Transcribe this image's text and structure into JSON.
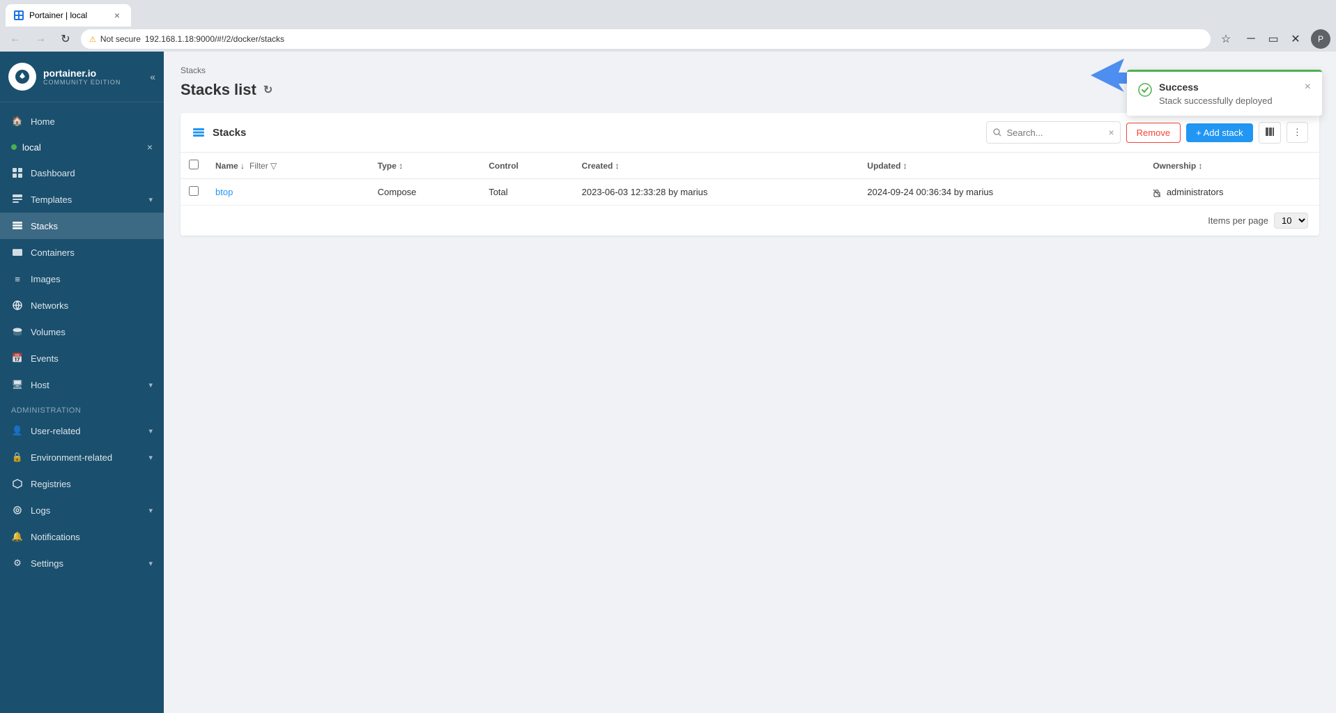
{
  "browser": {
    "tab_title": "Portainer | local",
    "address": "192.168.1.18:9000/#!/2/docker/stacks",
    "not_secure_label": "Not secure"
  },
  "sidebar": {
    "logo_name": "portainer.io",
    "logo_edition": "COMMUNITY EDITION",
    "collapse_btn": "«",
    "env_name": "local",
    "env_close": "×",
    "nav_items": [
      {
        "id": "home",
        "label": "Home",
        "icon": "🏠"
      },
      {
        "id": "dashboard",
        "label": "Dashboard",
        "icon": "📊"
      },
      {
        "id": "templates",
        "label": "Templates",
        "icon": "📄",
        "has_arrow": true
      },
      {
        "id": "stacks",
        "label": "Stacks",
        "icon": "⊞",
        "active": true
      },
      {
        "id": "containers",
        "label": "Containers",
        "icon": "📦"
      },
      {
        "id": "images",
        "label": "Images",
        "icon": "🖼"
      },
      {
        "id": "networks",
        "label": "Networks",
        "icon": "🌐"
      },
      {
        "id": "volumes",
        "label": "Volumes",
        "icon": "💾"
      },
      {
        "id": "events",
        "label": "Events",
        "icon": "📅"
      },
      {
        "id": "host",
        "label": "Host",
        "icon": "🖥",
        "has_arrow": true
      }
    ],
    "admin_section": "Administration",
    "admin_items": [
      {
        "id": "user-related",
        "label": "User-related",
        "has_arrow": true
      },
      {
        "id": "environment-related",
        "label": "Environment-related",
        "has_arrow": true
      },
      {
        "id": "registries",
        "label": "Registries"
      },
      {
        "id": "logs",
        "label": "Logs",
        "has_arrow": true
      },
      {
        "id": "notifications",
        "label": "Notifications"
      },
      {
        "id": "settings",
        "label": "Settings",
        "has_arrow": true
      }
    ]
  },
  "page": {
    "breadcrumb": "Stacks",
    "title": "Stacks list"
  },
  "panel": {
    "title": "Stacks",
    "search_placeholder": "Search...",
    "remove_btn": "Remove",
    "add_btn": "+ Add stack",
    "table": {
      "columns": [
        "Name",
        "Type",
        "Control",
        "Created",
        "Updated",
        "Ownership"
      ],
      "rows": [
        {
          "name": "btop",
          "type": "Compose",
          "control": "Total",
          "created": "2023-06-03 12:33:28 by marius",
          "updated": "2024-09-24 00:36:34 by marius",
          "ownership": "administrators"
        }
      ]
    },
    "items_per_page_label": "Items per page",
    "items_per_page_value": "10"
  },
  "toast": {
    "title": "Success",
    "message": "Stack successfully deployed",
    "close_btn": "×"
  }
}
